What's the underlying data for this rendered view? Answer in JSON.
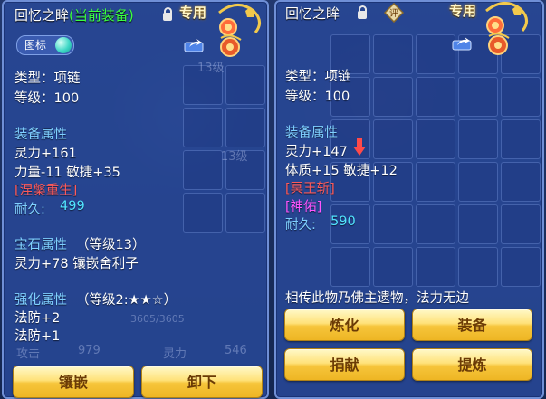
{
  "left": {
    "name": "回忆之眸",
    "status": "(当前装备)",
    "dedicated": "专用",
    "icon_toggle_label": "图标",
    "type_line": "类型：项链",
    "level_line": "等级：100",
    "equip_attr_title": "装备属性",
    "attr_lines": [
      "灵力+161",
      "力量-11 敏捷+35"
    ],
    "special_effect": "[涅槃重生]",
    "durability_label": "耐久:",
    "durability_value": "499",
    "gem_title": "宝石属性",
    "gem_level": "（等级13）",
    "gem_line": "灵力+78 镶嵌舍利子",
    "enhance_title": "强化属性",
    "enhance_level": "（等级2:★★☆）",
    "enhance_lines": [
      "法防+2",
      "法防+1"
    ],
    "buttons": {
      "inlay": "镶嵌",
      "unequip": "卸下"
    }
  },
  "right": {
    "name": "回忆之眸",
    "dedicated": "专用",
    "seal_glyph": "评",
    "type_line": "类型：项链",
    "level_line": "等级：100",
    "equip_attr_title": "装备属性",
    "attr_lines": [
      "灵力+147",
      "体质+15 敏捷+12"
    ],
    "special_effect": "[冥王斩]",
    "blessing": "[神佑]",
    "durability_label": "耐久:",
    "durability_value": "590",
    "description": "相传此物乃佛主遗物，法力无边",
    "buttons": {
      "refine": "炼化",
      "equip": "装备",
      "donate": "捐献",
      "purify": "提炼"
    }
  },
  "background": {
    "stat_a_label": "攻击",
    "stat_a_value": "979",
    "stat_b_label": "灵力",
    "stat_b_value": "546",
    "hp_text": "3605/3605",
    "item_level_a": "13级",
    "item_level_b": "13级"
  },
  "colors": {
    "panel": "#2848a0",
    "attr_title": "#7fd0ff",
    "special": "#ff5a5a",
    "blessing": "#ff55ff",
    "durability": "#52e5ff",
    "button_gold": "#f6c53b",
    "status_green": "#3bff42"
  },
  "icons": [
    "lock-icon",
    "share-icon",
    "tag-badge-icon",
    "gem-icon",
    "seal-icon",
    "red-down-arrow-icon"
  ]
}
